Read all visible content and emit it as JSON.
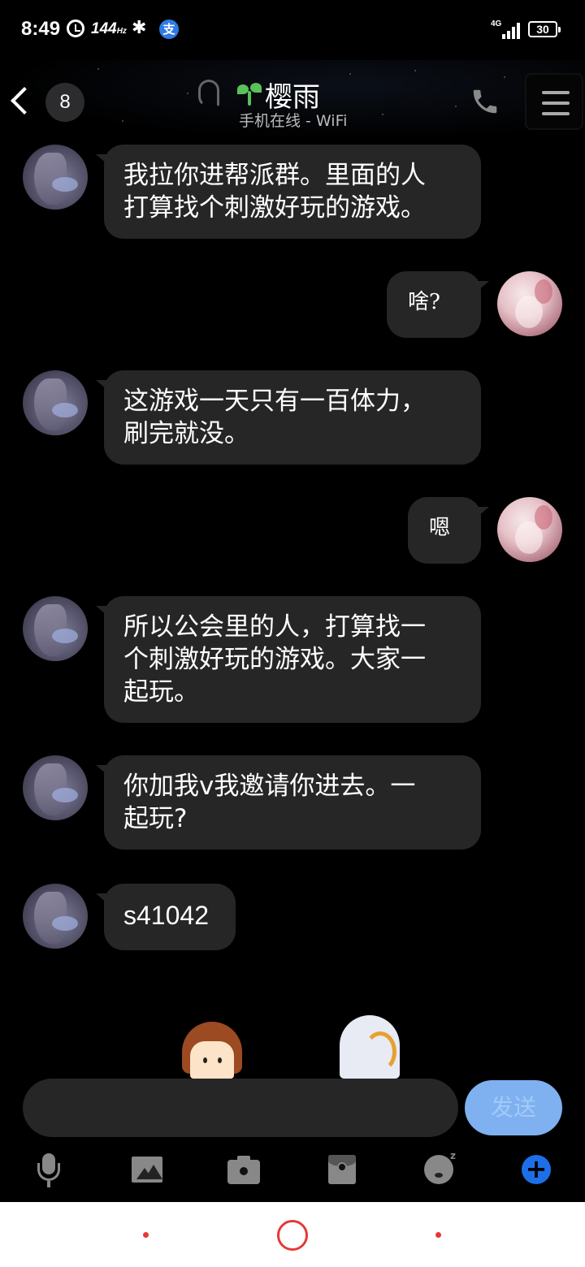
{
  "status_bar": {
    "time": "8:49",
    "refresh_rate": "144",
    "refresh_unit": "Hz",
    "network": "4G",
    "battery": "30"
  },
  "header": {
    "unread_count": "8",
    "contact_name": "樱雨",
    "contact_status": "手机在线 - WiFi"
  },
  "messages": [
    {
      "side": "left",
      "text": "我拉你进帮派群。里面的人\n打算找个刺激好玩的游戏。"
    },
    {
      "side": "right",
      "text": "啥?"
    },
    {
      "side": "left",
      "text": "这游戏一天只有一百体力，\n刷完就没。"
    },
    {
      "side": "right",
      "text": "嗯"
    },
    {
      "side": "left",
      "text": "所以公会里的人，打算找一\n个刺激好玩的游戏。大家一\n起玩。"
    },
    {
      "side": "left",
      "text": "你加我v我邀请你进去。一\n起玩?"
    },
    {
      "side": "left",
      "text": "s41042"
    }
  ],
  "composer": {
    "input_value": "",
    "send_label": "发送"
  },
  "toolbar": {
    "icons": [
      "microphone-icon",
      "image-icon",
      "camera-icon",
      "red-packet-icon",
      "emoji-icon",
      "plus-icon"
    ]
  },
  "colors": {
    "bubble": "#262626",
    "send_button": "#7fb1f0",
    "plus_button": "#1d6fe8",
    "nav_accent": "#e53935"
  }
}
